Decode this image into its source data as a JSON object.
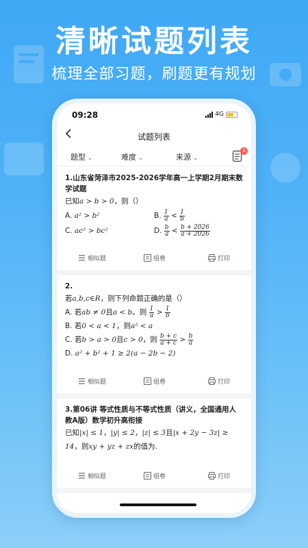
{
  "promo": {
    "headline": "清晰试题列表",
    "subline": "梳理全部习题，刷题更有规划"
  },
  "status": {
    "time": "09:28",
    "network": "4G"
  },
  "nav": {
    "title": "试题列表",
    "back_icon": "chevron-left-icon"
  },
  "filters": [
    {
      "label": "题型"
    },
    {
      "label": "难度"
    },
    {
      "label": "来源"
    }
  ],
  "basket": {
    "badge": "3"
  },
  "actions": {
    "similar": "相似题",
    "compose": "组卷",
    "print": "打印"
  },
  "questions": [
    {
      "title": "1.山东省菏泽市2025-2026学年高一上学期2月期末数学试题",
      "stem_pre": "已知",
      "stem_math": "a > b > 0",
      "stem_post": "，则（）",
      "opt_a_label": "A.",
      "opt_a": "a² > b²",
      "opt_b_label": "B.",
      "opt_b_n1": "1",
      "opt_b_d1": "a",
      "opt_b_rel": "<",
      "opt_b_n2": "1",
      "opt_b_d2": "b",
      "opt_c_label": "C.",
      "opt_c": "ac² > bc²",
      "opt_d_label": "D.",
      "opt_d_n1": "b",
      "opt_d_d1": "a",
      "opt_d_rel": "<",
      "opt_d_n2": "b + 2026",
      "opt_d_d2": "a + 2026"
    },
    {
      "title": "2.",
      "stem_pre": "若",
      "stem_math": "a,b,c∈R",
      "stem_post": "，则下列命题正确的是（）",
      "opt_a_label": "A.",
      "opt_a_pre": "若",
      "opt_a_math1": "ab ≠ 0",
      "opt_a_mid": "且",
      "opt_a_math2": "a < b",
      "opt_a_then": "。则",
      "opt_a_n1": "1",
      "opt_a_d1": "a",
      "opt_a_rel": ">",
      "opt_a_n2": "1",
      "opt_a_d2": "b",
      "opt_b_label": "B.",
      "opt_b_pre": "若",
      "opt_b_math1": "0 < a < 1",
      "opt_b_then": "，则",
      "opt_b_math2": "a² < a",
      "opt_c_label": "C.",
      "opt_c_pre": "若",
      "opt_c_math1": "b > a > 0",
      "opt_c_mid": "且",
      "opt_c_math2": "c > 0",
      "opt_c_then": "，则",
      "opt_c_n1": "b + c",
      "opt_c_d1": "a + c",
      "opt_c_rel": ">",
      "opt_c_n2": "b",
      "opt_c_d2": "a",
      "opt_d_label": "D.",
      "opt_d": "a² + b² + 1 ≥ 2(a − 2b − 2)"
    },
    {
      "title": "3.第06讲 等式性质与不等式性质（讲义，全国通用人教A版）数学初升高衔接",
      "stem_pre": "已知",
      "stem_math1": "|x| ≤ 1",
      "stem_sep1": "，",
      "stem_math2": "|y| ≤ 2",
      "stem_sep2": "，",
      "stem_math3": "|z| ≤ 3",
      "stem_mid": "且",
      "stem_math4": "|x + 2y − 3z| ≥ 14",
      "stem_then": "，则",
      "stem_math5": "xy + yz + zx",
      "stem_post": "的值为."
    }
  ]
}
